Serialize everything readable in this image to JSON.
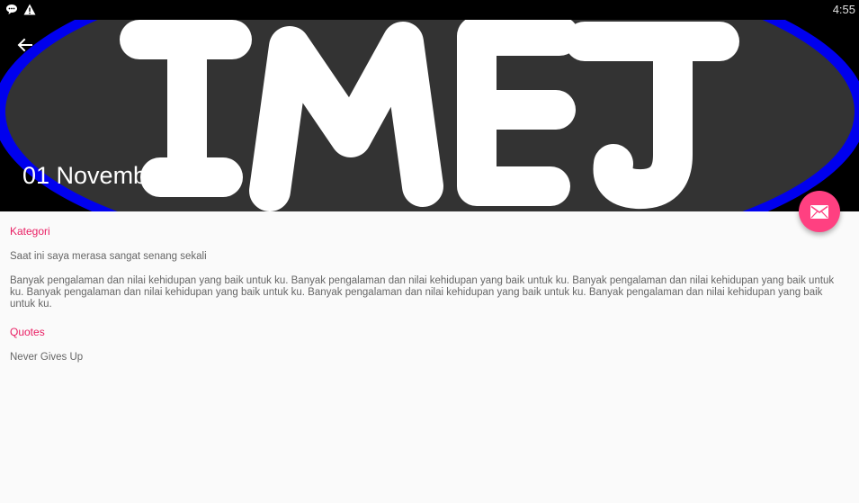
{
  "status_bar": {
    "time": "4:55",
    "icons": [
      "message-icon",
      "warning-icon"
    ]
  },
  "header": {
    "logo_text": "IMEJ",
    "date": "01 November 2016",
    "colors": {
      "ring": "#0000ee",
      "oval": "#333333",
      "letters": "#ffffff"
    }
  },
  "fab": {
    "icon": "email-icon",
    "color": "#ff4081"
  },
  "content": {
    "kategori_label": "Kategori",
    "kategori_text": "Saat ini saya merasa sangat senang sekali",
    "story_text": "Banyak pengalaman dan nilai kehidupan yang baik untuk ku. Banyak pengalaman dan nilai kehidupan yang baik untuk ku. Banyak pengalaman dan nilai kehidupan yang baik untuk ku. Banyak pengalaman dan nilai kehidupan yang baik untuk ku. Banyak pengalaman dan nilai kehidupan yang baik untuk ku. Banyak pengalaman dan nilai kehidupan yang baik untuk ku.",
    "quotes_label": "Quotes",
    "quotes_text": "Never Gives Up"
  }
}
